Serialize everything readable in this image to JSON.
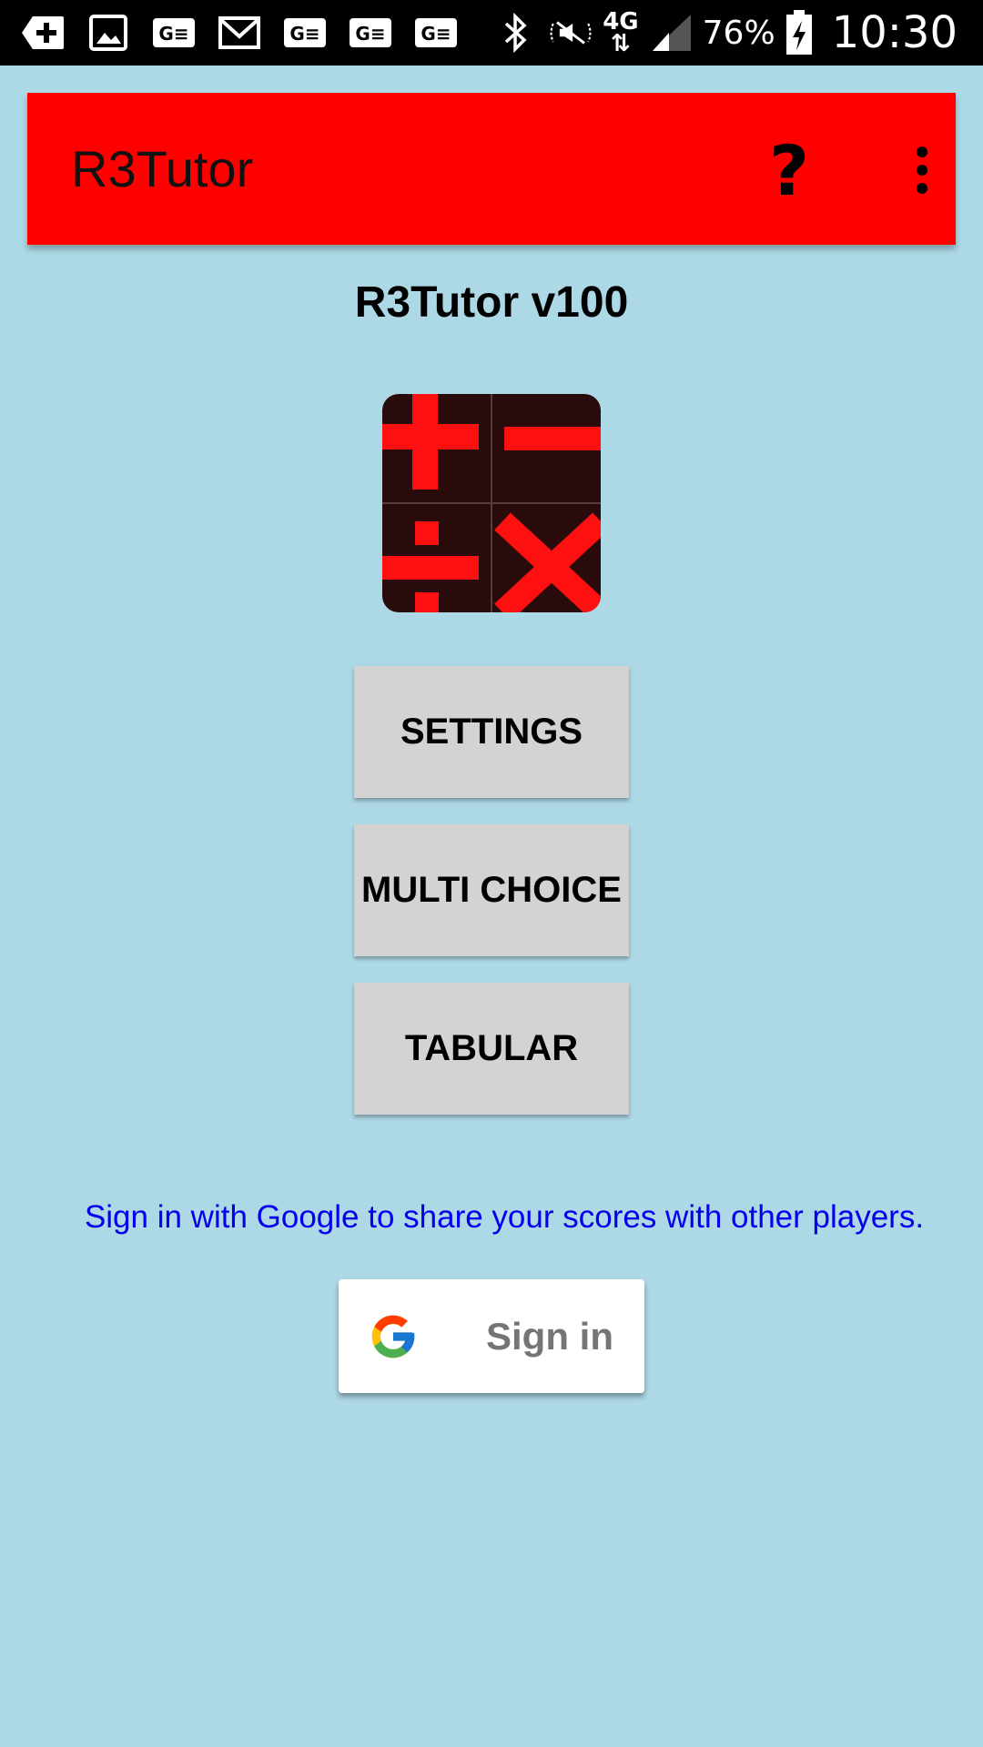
{
  "status_bar": {
    "network": "4G",
    "battery_percent": "76%",
    "time": "10:30",
    "left_icons": [
      "add-icon",
      "gallery-icon",
      "ge-icon",
      "gmail-icon",
      "ge-icon",
      "ge-icon",
      "ge-icon"
    ],
    "right_icons": [
      "bluetooth-icon",
      "mute-icon",
      "signal-icon",
      "battery-charging-icon"
    ]
  },
  "app_bar": {
    "title": "R3Tutor",
    "help_label": "?",
    "color": "#ff0000"
  },
  "main": {
    "heading": "R3Tutor v100",
    "logo_icon": "math-operators-icon",
    "buttons": {
      "settings": "SETTINGS",
      "multi_choice": "MULTI CHOICE",
      "tabular": "TABULAR"
    },
    "signin_prompt": "Sign in with Google to share your scores with other players.",
    "signin_button": "Sign in"
  },
  "colors": {
    "background": "#add8e6",
    "button": "#d3d3d3",
    "link_text": "#0000ee"
  }
}
